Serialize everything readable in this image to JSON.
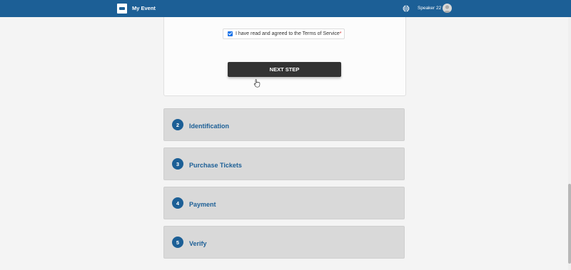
{
  "header": {
    "app_title": "My Event",
    "language_icon": "globe-icon",
    "user_name": "Speaker 22",
    "avatar_icon": "user-avatar-icon",
    "background_color": "#1c5f96"
  },
  "terms": {
    "label": "I have read and agreed to the Terms of Service",
    "required_marker": "*",
    "checked": true
  },
  "next_button": {
    "label": "NEXT STEP"
  },
  "steps": [
    {
      "number": "2",
      "title": "Identification"
    },
    {
      "number": "3",
      "title": "Purchase Tickets"
    },
    {
      "number": "4",
      "title": "Payment"
    },
    {
      "number": "5",
      "title": "Verify"
    }
  ],
  "colors": {
    "primary": "#1c5f96",
    "button": "#333333",
    "step_background": "#d9d9d9",
    "page_background": "#f4f4f4"
  }
}
